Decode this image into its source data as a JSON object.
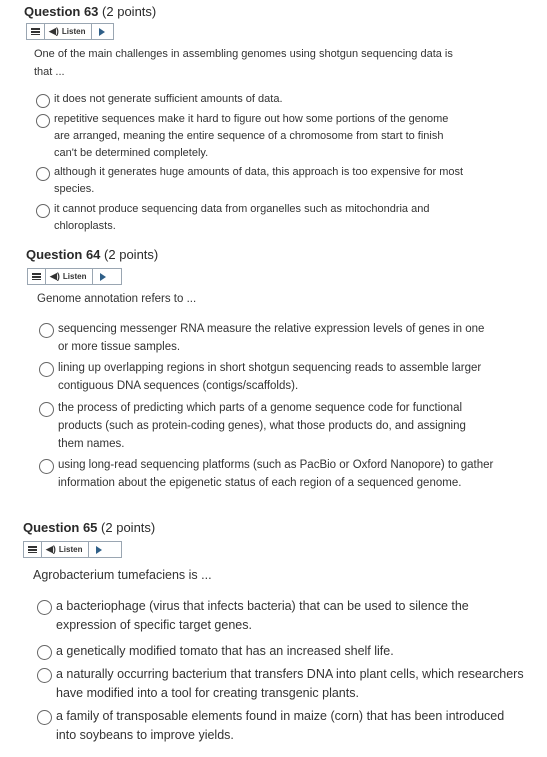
{
  "listen_label": "Listen",
  "questions": [
    {
      "number": "Question 63",
      "points": "(2 points)",
      "prompt": "One of the main challenges in assembling genomes using shotgun sequencing data is that ...",
      "options": [
        "it does not generate sufficient amounts of data.",
        "repetitive sequences make it hard to figure out how some portions of the genome are arranged, meaning the entire sequence of a chromosome from start to finish can't be determined completely.",
        "although it generates huge amounts of data, this approach is too expensive for most species.",
        "it cannot produce sequencing data from organelles such as mitochondria and chloroplasts."
      ]
    },
    {
      "number": "Question 64",
      "points": "(2 points)",
      "prompt": "Genome annotation refers to ...",
      "options": [
        "sequencing messenger RNA measure the relative expression levels of genes in one or more tissue samples.",
        "lining up overlapping regions in short shotgun sequencing reads to assemble larger contiguous DNA sequences (contigs/scaffolds).",
        "the process of predicting which parts of a genome sequence code for functional products (such as protein-coding genes), what those products do, and assigning them names.",
        "using long-read sequencing platforms (such as PacBio or Oxford Nanopore) to gather information about the epigenetic status of each region of a sequenced genome."
      ]
    },
    {
      "number": "Question 65",
      "points": "(2 points)",
      "prompt": "Agrobacterium tumefaciens is ...",
      "options": [
        "a bacteriophage (virus that infects bacteria) that can be used to silence the expression of specific target genes.",
        "a genetically modified tomato that has an increased shelf life.",
        "a naturally occurring bacterium that transfers DNA into plant cells, which researchers have modified into a tool for creating transgenic plants.",
        "a family of transposable elements found in maize (corn) that has been introduced into soybeans to improve yields."
      ]
    }
  ]
}
